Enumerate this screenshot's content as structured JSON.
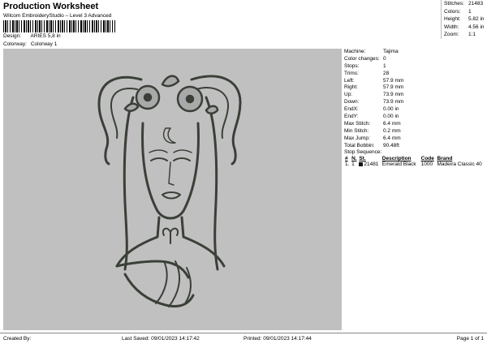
{
  "header": {
    "title": "Production Worksheet",
    "subtitle": "Wilcom EmbroideryStudio – Level 3 Advanced",
    "design_label": "Design:",
    "design_value": "ARIES 5,8 in",
    "colorway_label": "Colorway:",
    "colorway_value": "Colorway 1"
  },
  "top_stats": [
    {
      "label": "Stitches:",
      "value": "21483"
    },
    {
      "label": "Colors:",
      "value": "1"
    },
    {
      "label": "Height:",
      "value": "5.82 in"
    },
    {
      "label": "Width:",
      "value": "4.56 in"
    },
    {
      "label": "Zoom:",
      "value": "1:1"
    }
  ],
  "machine_info": [
    {
      "label": "Machine:",
      "value": "Tajima"
    },
    {
      "label": "Color changes:",
      "value": "0"
    },
    {
      "label": "Stops:",
      "value": "1"
    },
    {
      "label": "Trims:",
      "value": "28"
    },
    {
      "label": "Left:",
      "value": "57.9 mm"
    },
    {
      "label": "Right:",
      "value": "57.9 mm"
    },
    {
      "label": "Up:",
      "value": "73.9 mm"
    },
    {
      "label": "Down:",
      "value": "73.9 mm"
    },
    {
      "label": "EndX:",
      "value": "0.00 in"
    },
    {
      "label": "EndY:",
      "value": "0.00 in"
    },
    {
      "label": "Max Stitch:",
      "value": "6.4 mm"
    },
    {
      "label": "Min Stitch:",
      "value": "0.2 mm"
    },
    {
      "label": "Max Jump:",
      "value": "6.4 mm"
    },
    {
      "label": "Total Bobbin:",
      "value": "90.48ft"
    }
  ],
  "stop_sequence": {
    "title": "Stop Sequence:",
    "columns": [
      "#",
      "N.",
      "St.",
      "Description",
      "Code",
      "Brand"
    ],
    "rows": [
      {
        "num": "1.",
        "n": "1",
        "swatch": "#141414",
        "st": "21481",
        "description": "Emerald Black",
        "code": "1000",
        "brand": "Madeira Classic 40"
      }
    ]
  },
  "footer": {
    "created_by": "Created By:",
    "last_saved": "Last Saved: 09/01/2023 14:17:42",
    "printed": "Printed: 09/01/2023 14:17:44",
    "page": "Page 1 of 1"
  },
  "colors": {
    "design_background": "#c0c0c0",
    "thread": "#3a4038",
    "fill": "#a9a9a9"
  }
}
